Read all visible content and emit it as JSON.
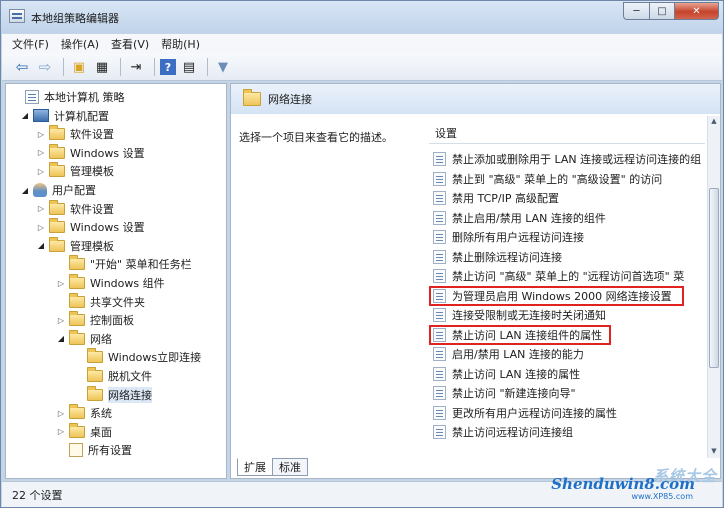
{
  "window": {
    "title": "本地组策略编辑器",
    "minimize": "─",
    "maximize": "□",
    "close": "✕"
  },
  "menu": [
    "文件(F)",
    "操作(A)",
    "查看(V)",
    "帮助(H)"
  ],
  "toolbar_icons": [
    "back-arrow-icon",
    "forward-arrow-icon",
    "folder-up-icon",
    "show-hide-tree-icon",
    "export-list-icon",
    "help-icon",
    "properties-icon",
    "filter-icon"
  ],
  "tree": [
    {
      "label": "本地计算机 策略",
      "icon": "doc-icon",
      "toggle": "",
      "level": 0
    },
    {
      "label": "计算机配置",
      "icon": "computer-icon",
      "toggle": "◢",
      "level": 1
    },
    {
      "label": "软件设置",
      "icon": "folder-icon",
      "toggle": "▷",
      "level": 2
    },
    {
      "label": "Windows 设置",
      "icon": "folder-icon",
      "toggle": "▷",
      "level": 2
    },
    {
      "label": "管理模板",
      "icon": "folder-icon",
      "toggle": "▷",
      "level": 2
    },
    {
      "label": "用户配置",
      "icon": "user-icon",
      "toggle": "◢",
      "level": 1
    },
    {
      "label": "软件设置",
      "icon": "folder-icon",
      "toggle": "▷",
      "level": 2
    },
    {
      "label": "Windows 设置",
      "icon": "folder-icon",
      "toggle": "▷",
      "level": 2
    },
    {
      "label": "管理模板",
      "icon": "folder-icon",
      "toggle": "◢",
      "level": 2
    },
    {
      "label": "\"开始\" 菜单和任务栏",
      "icon": "folder-icon",
      "toggle": "",
      "level": 3
    },
    {
      "label": "Windows 组件",
      "icon": "folder-icon",
      "toggle": "▷",
      "level": 3
    },
    {
      "label": "共享文件夹",
      "icon": "folder-icon",
      "toggle": "",
      "level": 3
    },
    {
      "label": "控制面板",
      "icon": "folder-icon",
      "toggle": "▷",
      "level": 3
    },
    {
      "label": "网络",
      "icon": "folder-icon",
      "toggle": "◢",
      "level": 3
    },
    {
      "label": "Windows立即连接",
      "icon": "folder-icon",
      "toggle": "",
      "level": 4
    },
    {
      "label": "脱机文件",
      "icon": "folder-icon",
      "toggle": "",
      "level": 4
    },
    {
      "label": "网络连接",
      "icon": "folder-icon",
      "toggle": "",
      "level": 4,
      "selected": true
    },
    {
      "label": "系统",
      "icon": "folder-icon",
      "toggle": "▷",
      "level": 3
    },
    {
      "label": "桌面",
      "icon": "folder-icon",
      "toggle": "▷",
      "level": 3
    },
    {
      "label": "所有设置",
      "icon": "all-settings-icon",
      "toggle": "",
      "level": 3
    }
  ],
  "right": {
    "header_title": "网络连接",
    "description": "选择一个项目来查看它的描述。",
    "column_header": "设置",
    "settings": [
      "禁止添加或删除用于 LAN 连接或远程访问连接的组",
      "禁止到 \"高级\" 菜单上的 \"高级设置\" 的访问",
      "禁用 TCP/IP 高级配置",
      "禁止启用/禁用 LAN 连接的组件",
      "删除所有用户远程访问连接",
      "禁止删除远程访问连接",
      "禁止访问 \"高级\" 菜单上的 \"远程访问首选项\" 菜",
      "为管理员启用 Windows 2000 网络连接设置",
      "连接受限制或无连接时关闭通知",
      "禁止访问 LAN 连接组件的属性",
      "启用/禁用 LAN 连接的能力",
      "禁止访问 LAN 连接的属性",
      "禁止访问 \"新建连接向导\"",
      "更改所有用户远程访问连接的属性",
      "禁止访问远程访问连接组"
    ],
    "highlighted": [
      7,
      9
    ],
    "tabs": [
      "扩展",
      "标准"
    ],
    "active_tab": 0
  },
  "status": "22 个设置",
  "watermark": {
    "top": "系统大全",
    "main": "Shenduwin8.com",
    "sub": "www.XP85.com"
  },
  "colors": {
    "highlight_border": "#e0231f",
    "selection": "#dde8f6",
    "frame": "#c5d5e8"
  }
}
